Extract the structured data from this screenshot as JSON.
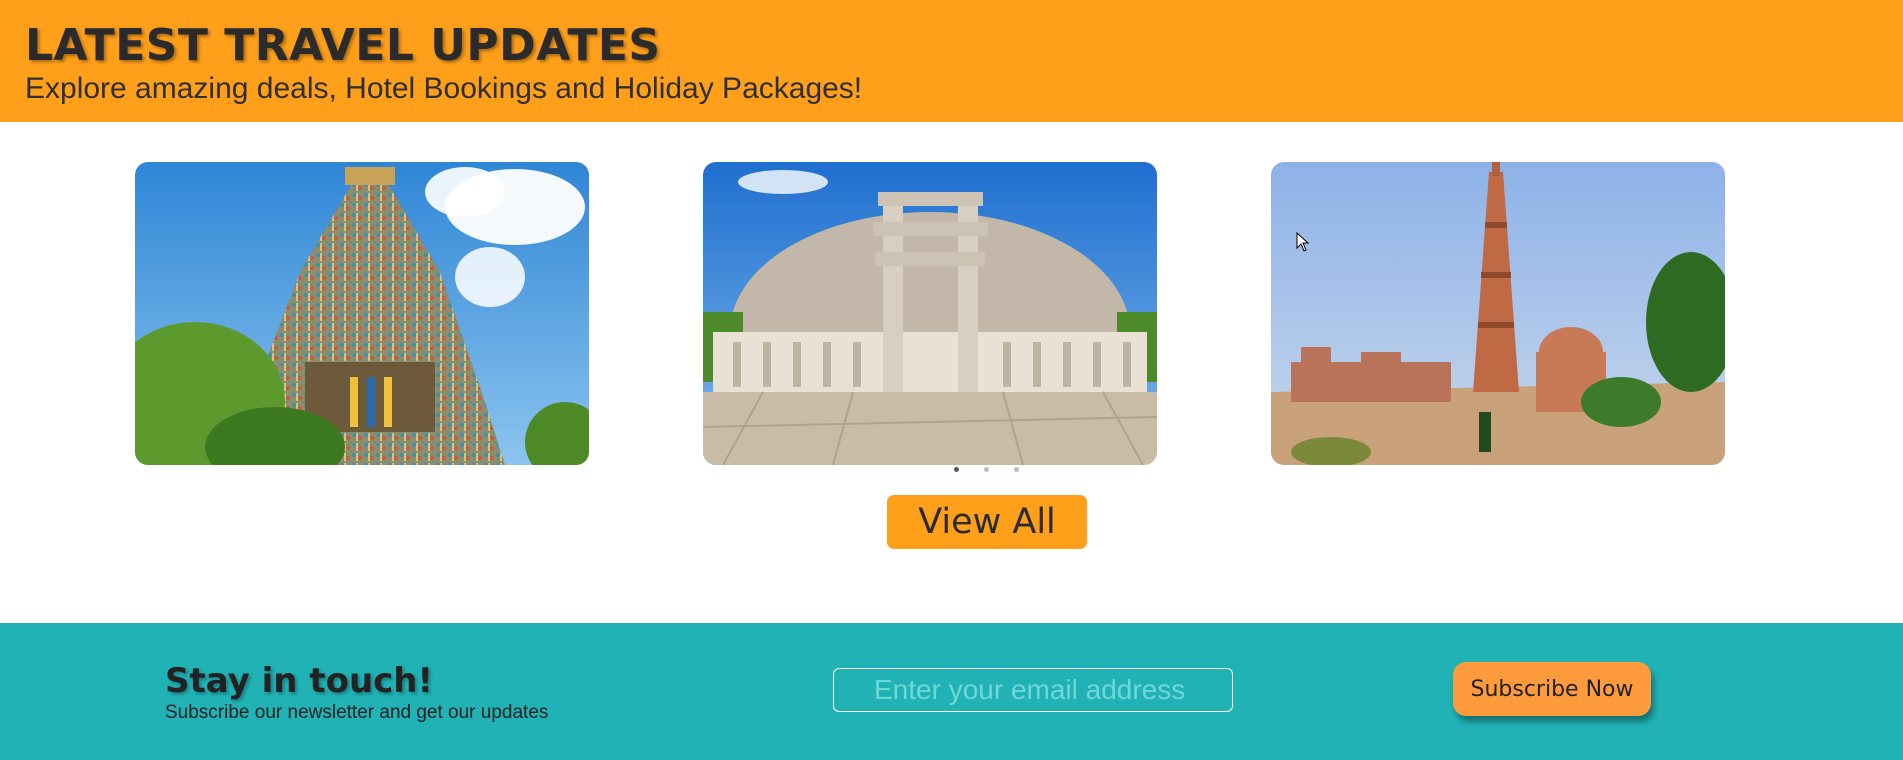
{
  "header": {
    "title": "LATEST TRAVEL UPDATES",
    "subtitle": "Explore amazing deals, Hotel Bookings and Holiday Packages!"
  },
  "carousel": {
    "slides": [
      "temple-gopuram-photo",
      "stupa-gateway-photo",
      "minar-tower-photo"
    ],
    "indicator_count": 3,
    "active_indicator": 1
  },
  "view_all_label": "View All",
  "newsletter": {
    "title": "Stay in touch!",
    "subtitle": "Subscribe our newsletter and get our updates",
    "email_placeholder": "Enter your email address",
    "email_value": "",
    "subscribe_label": "Subscribe Now"
  },
  "colors": {
    "header_bg": "#ff9f1a",
    "footer_bg": "#20b2b5",
    "button_orange": "#ff9f1a",
    "subscribe_orange": "#ff9a3d"
  }
}
